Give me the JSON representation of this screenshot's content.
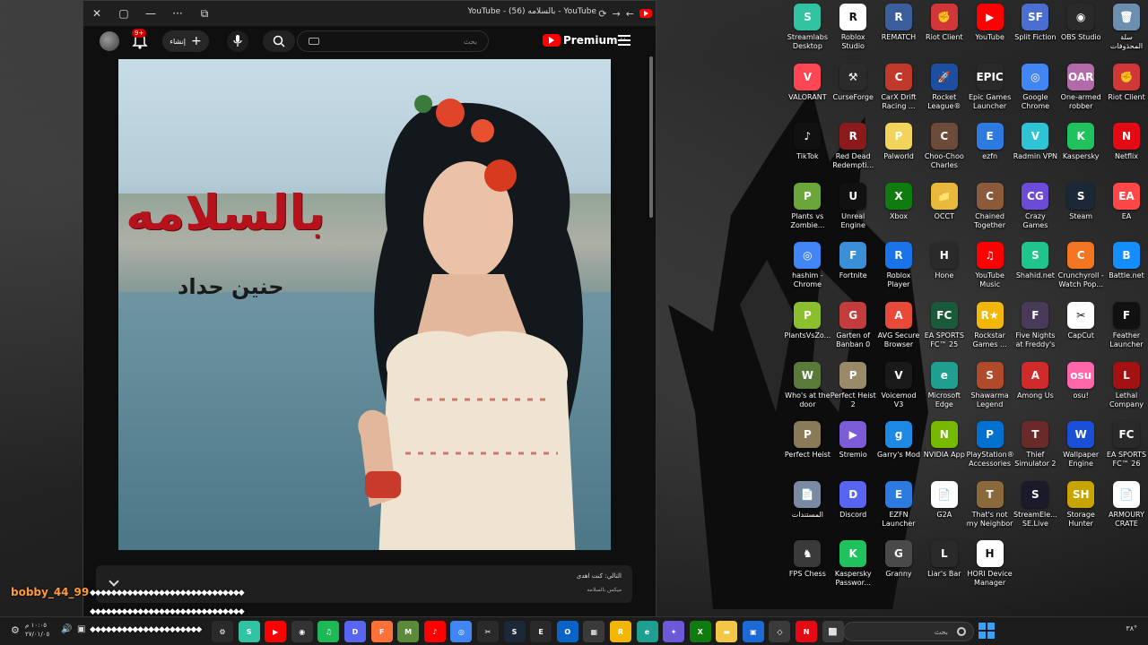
{
  "window": {
    "title": "YouTube - (56) بالسلامه - YouTube",
    "close": "✕",
    "maximize": "▢",
    "minimize": "—",
    "more": "···"
  },
  "youtube": {
    "notif_count": "9+",
    "create_label": "إنشاء",
    "search_placeholder": "بحث",
    "brand": "Premium",
    "region": "SA"
  },
  "video": {
    "overlay_title": "بالسلامه",
    "overlay_artist": "حنين حداد"
  },
  "queue": {
    "next_label": "التالي: كنت اهدى",
    "sub_label": "ميكس بالسلامه"
  },
  "overlay": {
    "username": "bobby_44_99",
    "msg1": "◆◆◆◆◆◆◆◆◆◆◆◆◆◆◆◆◆◆◆◆◆◆◆◆◆◆◆◆◆",
    "msg2": "◆◆◆◆◆◆◆◆◆◆◆◆◆◆◆◆◆◆◆◆◆◆◆◆◆◆◆◆◆",
    "msg3": "◆◆◆◆◆◆◆◆◆◆◆◆◆◆◆◆◆◆◆◆◆"
  },
  "desktop_icons": [
    {
      "label": "Streamlabs Desktop",
      "color": "#31c3a2",
      "glyph": "S"
    },
    {
      "label": "Roblox Studio",
      "color": "#ffffff",
      "glyph": "R"
    },
    {
      "label": "REMATCH",
      "color": "#3a5f9c",
      "glyph": "R"
    },
    {
      "label": "Riot Client",
      "color": "#d13639",
      "glyph": "✊"
    },
    {
      "label": "YouTube",
      "color": "#ff0000",
      "glyph": "▶"
    },
    {
      "label": "Split Fiction",
      "color": "#4a6fd1",
      "glyph": "SF"
    },
    {
      "label": "OBS Studio",
      "color": "#2a2a2a",
      "glyph": "◉"
    },
    {
      "label": "سلة المحذوفات",
      "color": "#6c8fb0",
      "glyph": "🗑"
    },
    {
      "label": "VALORANT",
      "color": "#ff4655",
      "glyph": "V"
    },
    {
      "label": "CurseForge",
      "color": "#2b2b2b",
      "glyph": "⚒"
    },
    {
      "label": "CarX Drift Racing ...",
      "color": "#c0392b",
      "glyph": "C"
    },
    {
      "label": "Rocket League®",
      "color": "#1c4fa0",
      "glyph": "🚀"
    },
    {
      "label": "Epic Games Launcher",
      "color": "#2a2a2a",
      "glyph": "EPIC"
    },
    {
      "label": "Google Chrome",
      "color": "#4285f4",
      "glyph": "◎"
    },
    {
      "label": "One-armed robber",
      "color": "#b36aa8",
      "glyph": "OAR"
    },
    {
      "label": "Riot Client",
      "color": "#d13639",
      "glyph": "✊"
    },
    {
      "label": "TikTok",
      "color": "#111111",
      "glyph": "♪"
    },
    {
      "label": "Red Dead Redempti...",
      "color": "#8b1a1a",
      "glyph": "R"
    },
    {
      "label": "Palworld",
      "color": "#f2d35b",
      "glyph": "P"
    },
    {
      "label": "Choo-Choo Charles",
      "color": "#6b4b3a",
      "glyph": "C"
    },
    {
      "label": "ezfn",
      "color": "#2d7be0",
      "glyph": "E"
    },
    {
      "label": "Radmin VPN",
      "color": "#2ec4d6",
      "glyph": "V"
    },
    {
      "label": "Kaspersky",
      "color": "#20c25e",
      "glyph": "K"
    },
    {
      "label": "Netflix",
      "color": "#e50914",
      "glyph": "N"
    },
    {
      "label": "Plants vs Zombie...",
      "color": "#6aa63a",
      "glyph": "P"
    },
    {
      "label": "Unreal Engine",
      "color": "#111111",
      "glyph": "U"
    },
    {
      "label": "Xbox",
      "color": "#107c10",
      "glyph": "X"
    },
    {
      "label": "OCCT",
      "color": "#e9b93b",
      "glyph": "📁"
    },
    {
      "label": "Chained Together",
      "color": "#8a5a3a",
      "glyph": "C"
    },
    {
      "label": "Crazy Games",
      "color": "#6c4bd8",
      "glyph": "CG"
    },
    {
      "label": "Steam",
      "color": "#1b2838",
      "glyph": "S"
    },
    {
      "label": "EA",
      "color": "#ff4747",
      "glyph": "EA"
    },
    {
      "label": "hashim - Chrome",
      "color": "#4285f4",
      "glyph": "◎"
    },
    {
      "label": "Fortnite",
      "color": "#3a8fd8",
      "glyph": "F"
    },
    {
      "label": "Roblox Player",
      "color": "#1a73e8",
      "glyph": "R"
    },
    {
      "label": "Hone",
      "color": "#2a2a2a",
      "glyph": "H"
    },
    {
      "label": "YouTube Music",
      "color": "#ff0000",
      "glyph": "♫"
    },
    {
      "label": "Shahid.net",
      "color": "#1fc58d",
      "glyph": "S"
    },
    {
      "label": "Crunchyroll - Watch Pop...",
      "color": "#f47521",
      "glyph": "C"
    },
    {
      "label": "Battle.net",
      "color": "#148eff",
      "glyph": "B"
    },
    {
      "label": "PlantsVsZo...",
      "color": "#8bbf2e",
      "glyph": "P"
    },
    {
      "label": "Garten of Banban 0",
      "color": "#c43b3b",
      "glyph": "G"
    },
    {
      "label": "AVG Secure Browser",
      "color": "#e84a3a",
      "glyph": "A"
    },
    {
      "label": "EA SPORTS FC™ 25",
      "color": "#1a5a3a",
      "glyph": "FC"
    },
    {
      "label": "Rockstar Games ...",
      "color": "#f2b705",
      "glyph": "R★"
    },
    {
      "label": "Five Nights at Freddy's Int...",
      "color": "#4a3a5a",
      "glyph": "F"
    },
    {
      "label": "CapCut",
      "color": "#ffffff",
      "glyph": "✂"
    },
    {
      "label": "Feather Launcher",
      "color": "#111111",
      "glyph": "F"
    },
    {
      "label": "Who's at the door",
      "color": "#5a7a3a",
      "glyph": "W"
    },
    {
      "label": "Perfect Heist 2",
      "color": "#9a8a6a",
      "glyph": "P"
    },
    {
      "label": "Voicemod V3",
      "color": "#1a1a1a",
      "glyph": "V"
    },
    {
      "label": "Microsoft Edge",
      "color": "#1e9f8f",
      "glyph": "e"
    },
    {
      "label": "Shawarma Legend",
      "color": "#b04a2a",
      "glyph": "S"
    },
    {
      "label": "Among Us",
      "color": "#d12a2a",
      "glyph": "A"
    },
    {
      "label": "osu!",
      "color": "#ff66aa",
      "glyph": "osu"
    },
    {
      "label": "Lethal Company",
      "color": "#a31212",
      "glyph": "L"
    },
    {
      "label": "Perfect Heist",
      "color": "#8a7a5a",
      "glyph": "P"
    },
    {
      "label": "Stremio",
      "color": "#7b5bd6",
      "glyph": "▶"
    },
    {
      "label": "Garry's Mod",
      "color": "#1e88e5",
      "glyph": "g"
    },
    {
      "label": "NVIDIA App",
      "color": "#76b900",
      "glyph": "N"
    },
    {
      "label": "PlayStation® Accessories",
      "color": "#0070d1",
      "glyph": "P"
    },
    {
      "label": "Thief Simulator 2",
      "color": "#6a2a2a",
      "glyph": "T"
    },
    {
      "label": "Wallpaper Engine",
      "color": "#1a4fd8",
      "glyph": "W"
    },
    {
      "label": "EA SPORTS FC™ 26",
      "color": "#2a2a2a",
      "glyph": "FC"
    },
    {
      "label": "المستندات",
      "color": "#7a8aa0",
      "glyph": "📄"
    },
    {
      "label": "Discord",
      "color": "#5865f2",
      "glyph": "D"
    },
    {
      "label": "EZFN Launcher",
      "color": "#2d7be0",
      "glyph": "E"
    },
    {
      "label": "G2A",
      "color": "#ffffff",
      "glyph": "📄"
    },
    {
      "label": "That's not my Neighbor",
      "color": "#8a6a3a",
      "glyph": "T"
    },
    {
      "label": "StreamEle... SE.Live",
      "color": "#1a1a2a",
      "glyph": "S"
    },
    {
      "label": "Storage Hunter",
      "color": "#c8a400",
      "glyph": "SH"
    },
    {
      "label": "ARMOURY CRATE",
      "color": "#ffffff",
      "glyph": "📄"
    },
    {
      "label": "FPS Chess",
      "color": "#3a3a3a",
      "glyph": "♞"
    },
    {
      "label": "Kaspersky Passwor...",
      "color": "#20c25e",
      "glyph": "K"
    },
    {
      "label": "Granny",
      "color": "#4a4a4a",
      "glyph": "G"
    },
    {
      "label": "Liar's Bar",
      "color": "#2a2a2a",
      "glyph": "L"
    },
    {
      "label": "HORI Device Manager",
      "color": "#ffffff",
      "glyph": "H"
    }
  ],
  "taskbar": {
    "clock_time": "١٠:٠٥ م",
    "clock_date": "٢٧/٠١/٠٥",
    "search_placeholder": "بحث",
    "tray_temp": "٣٨°",
    "icons": [
      {
        "name": "chatgpt-icon",
        "color": "#2a2a2a",
        "glyph": "⚙"
      },
      {
        "name": "streamlabs-taskbar-icon",
        "color": "#31c3a2",
        "glyph": "S"
      },
      {
        "name": "youtube-taskbar-icon",
        "color": "#ff0000",
        "glyph": "▶"
      },
      {
        "name": "obs-taskbar-icon",
        "color": "#333333",
        "glyph": "◉"
      },
      {
        "name": "spotify-icon",
        "color": "#1db954",
        "glyph": "♫"
      },
      {
        "name": "discord-taskbar-icon",
        "color": "#5865f2",
        "glyph": "D"
      },
      {
        "name": "firefox-icon",
        "color": "#ff7139",
        "glyph": "F"
      },
      {
        "name": "minecraft-icon",
        "color": "#5a8a3a",
        "glyph": "M"
      },
      {
        "name": "ytmusic-taskbar-icon",
        "color": "#ff0000",
        "glyph": "♪"
      },
      {
        "name": "chrome-taskbar-icon",
        "color": "#4285f4",
        "glyph": "◎"
      },
      {
        "name": "capcut-taskbar-icon",
        "color": "#2a2a2a",
        "glyph": "✂"
      },
      {
        "name": "steam-taskbar-icon",
        "color": "#1b2838",
        "glyph": "S"
      },
      {
        "name": "epic-taskbar-icon",
        "color": "#2a2a2a",
        "glyph": "E"
      },
      {
        "name": "outlook-icon",
        "color": "#0a64c8",
        "glyph": "O"
      },
      {
        "name": "store-icon",
        "color": "#3a3a3a",
        "glyph": "▦"
      },
      {
        "name": "rockstar-taskbar-icon",
        "color": "#f2b705",
        "glyph": "R"
      },
      {
        "name": "edge-taskbar-icon",
        "color": "#1e9f8f",
        "glyph": "e"
      },
      {
        "name": "copilot-icon",
        "color": "#6a5ad8",
        "glyph": "✦"
      },
      {
        "name": "xbox-taskbar-icon",
        "color": "#107c10",
        "glyph": "X"
      },
      {
        "name": "file-explorer-icon",
        "color": "#f2c744",
        "glyph": "▬"
      },
      {
        "name": "photos-icon",
        "color": "#1a6ad8",
        "glyph": "▣"
      },
      {
        "name": "unity-icon",
        "color": "#3a3a3a",
        "glyph": "◇"
      },
      {
        "name": "netflix-taskbar-icon",
        "color": "#e50914",
        "glyph": "N"
      },
      {
        "name": "windows-security-icon",
        "color": "#3a3a3a",
        "glyph": "⬜"
      }
    ]
  }
}
